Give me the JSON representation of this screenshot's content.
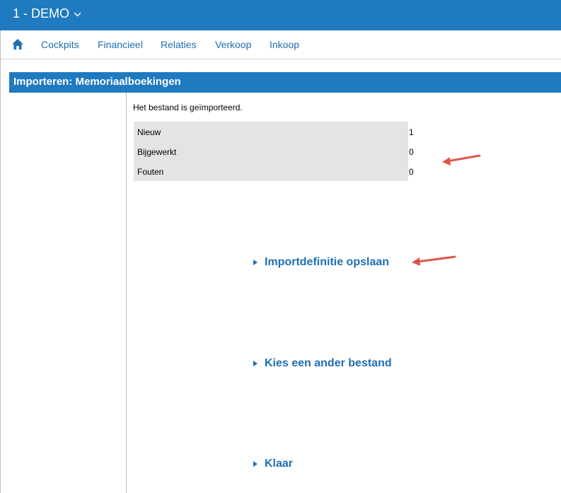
{
  "header": {
    "company_label": "1 - DEMO",
    "bg_color": "#1f7ac0"
  },
  "nav": {
    "home_icon": "home-icon",
    "items": [
      "Cockpits",
      "Financieel",
      "Relaties",
      "Verkoop",
      "Inkoop"
    ]
  },
  "page": {
    "title": "Importeren: Memoriaalboekingen",
    "status_message": "Het bestand is geïmporteerd."
  },
  "results": [
    {
      "label": "Nieuw",
      "value": "1"
    },
    {
      "label": "Bijgewerkt",
      "value": "0"
    },
    {
      "label": "Fouten",
      "value": "0"
    }
  ],
  "actions": {
    "save_definition": "Importdefinitie opslaan",
    "choose_other_file": "Kies een ander bestand",
    "done": "Klaar"
  },
  "annotation_color": "#e0554a"
}
